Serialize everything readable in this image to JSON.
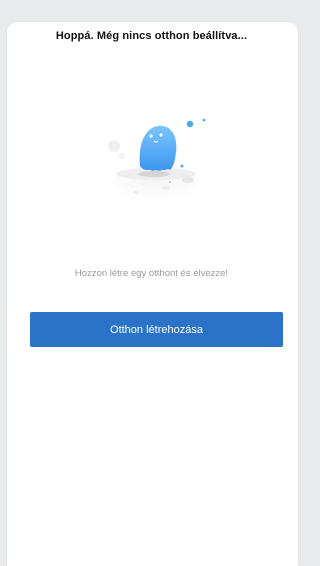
{
  "header": {
    "title": "Hoppá. Még nincs otthon beállítva..."
  },
  "empty_state": {
    "illustration": "ghost-planet-illustration",
    "message": "Hozzon létre egy otthont és élvezze!"
  },
  "actions": {
    "create_home_label": "Otthon létrehozása"
  },
  "colors": {
    "accent": "#2a73c8",
    "ghost": "#4aa6f2",
    "muted_text": "#9a9a9a",
    "background": "#e9eaec"
  }
}
